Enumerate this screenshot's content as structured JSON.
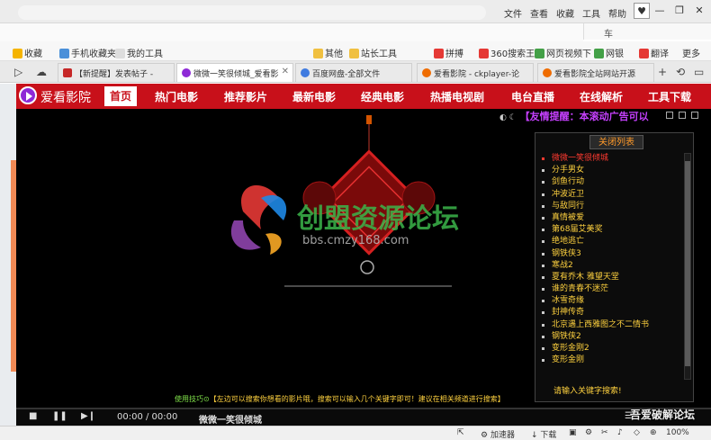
{
  "titlebar": {
    "menu": [
      "文件",
      "查看",
      "收藏",
      "工具",
      "帮助"
    ],
    "shield_label": "♥",
    "minimize": "—",
    "maximize": "❐",
    "close": "✕"
  },
  "search": {
    "placeholder": "车"
  },
  "bookmarks": [
    {
      "label": "收藏",
      "color": "#f5b400"
    },
    {
      "label": "手机收藏夹",
      "color": "#4a90d9"
    },
    {
      "label": "我的工具",
      "color": "#ccc"
    },
    {
      "label": "其他",
      "color": "#f0c040"
    },
    {
      "label": "站长工具",
      "color": "#f0c040"
    },
    {
      "label": "拼搏",
      "color": "#e53935"
    },
    {
      "label": "360搜索王",
      "color": "#e53935"
    },
    {
      "label": "网页视频下",
      "color": "#43a047"
    },
    {
      "label": "网银",
      "color": "#43a047"
    },
    {
      "label": "翻译",
      "color": "#e53935"
    },
    {
      "label": "更多",
      "color": "#888"
    }
  ],
  "tabs": [
    {
      "label": "【新提醒】发表帖子 -",
      "color": "#c62828",
      "active": false
    },
    {
      "label": "微微一笑很倾城_爱看影",
      "color": "#8e2ad6",
      "active": true
    },
    {
      "label": "百度网盘-全部文件",
      "color": "#3f7be0",
      "active": false
    },
    {
      "label": "爱看影院 - ckplayer-论",
      "color": "#ef6c00",
      "active": false
    },
    {
      "label": "爱看影院全站网站开源",
      "color": "#ef6c00",
      "active": false
    }
  ],
  "site": {
    "logo": "爱看影院",
    "nav": [
      "首页",
      "热门电影",
      "推荐影片",
      "最新电影",
      "经典电影",
      "热播电视剧",
      "电台直播",
      "在线解析",
      "工具下载"
    ]
  },
  "player": {
    "marquee_ctl": "◐ ☾",
    "marquee": "【友情提醒：本滚动广告可以",
    "watermark_cn": "创盟资源论坛",
    "watermark_url": "bbs.cmzy168.com",
    "tip_prefix": "使用技巧⊙",
    "tip_text": "【左边可以搜索你想看的影片哦，搜索可以输入几个关键字即可！建议在相关频道进行搜索】",
    "time": "00:00 / 00:00",
    "now_playing": "微微一笑很倾城",
    "corner_watermark": "吾爱破解论坛"
  },
  "playlist": {
    "header": "关闭列表",
    "items": [
      "微微一笑很倾城",
      "分手男女",
      "剑鱼行动",
      "冲波近卫",
      "与敌同行",
      "真情被爱",
      "第68届艾美奖",
      "绝地逃亡",
      "钢铁侠3",
      "寒战2",
      "夏有乔木 雅望天堂",
      "谁的青春不迷茫",
      "冰雪奇缘",
      "封神传奇",
      "北京遇上西雅图之不二情书",
      "钢铁侠2",
      "变形金刚2",
      "变形金刚"
    ],
    "search_placeholder": "请输入关键字搜索!"
  },
  "statusbar": {
    "accelerator": "加速器",
    "download": "下载",
    "zoom": "100%"
  }
}
